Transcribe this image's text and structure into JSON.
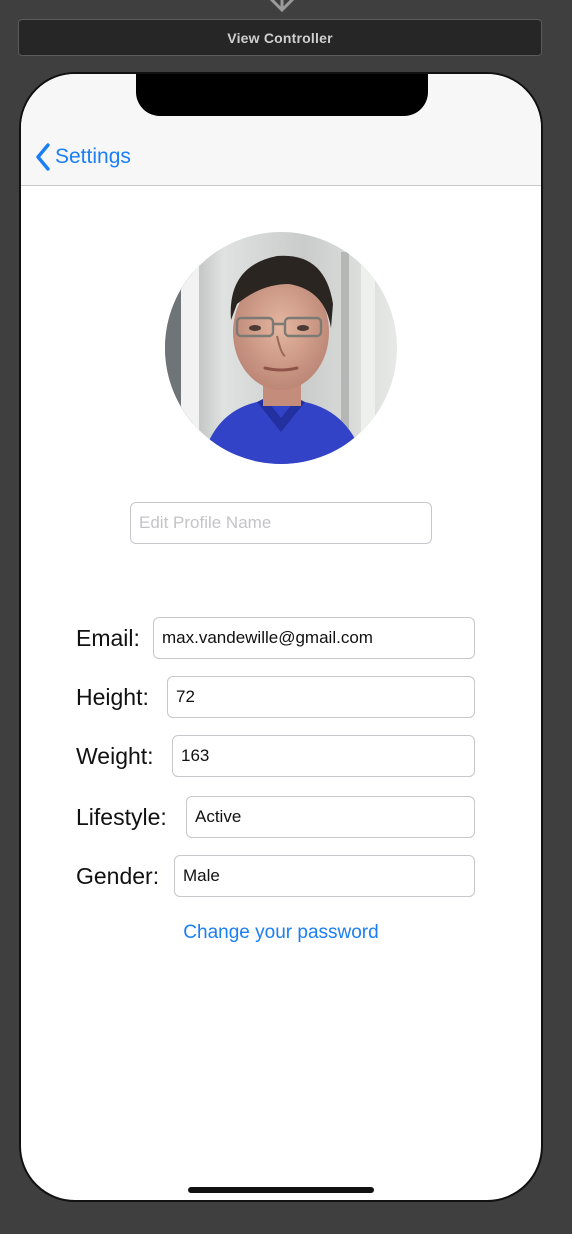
{
  "storyboard": {
    "scene_title": "View Controller"
  },
  "nav": {
    "back_label": "Settings"
  },
  "profile": {
    "name_placeholder": "Edit Profile Name",
    "name_value": ""
  },
  "fields": [
    {
      "label": "Email:",
      "value": "max.vandewille@gmail.com"
    },
    {
      "label": "Height:",
      "value": "72"
    },
    {
      "label": "Weight:",
      "value": "163"
    },
    {
      "label": "Lifestyle:",
      "value": "Active"
    },
    {
      "label": "Gender:",
      "value": "Male"
    }
  ],
  "actions": {
    "change_password": "Change your password"
  },
  "colors": {
    "tint": "#1a7ef5",
    "canvas": "#3f3f3f"
  }
}
